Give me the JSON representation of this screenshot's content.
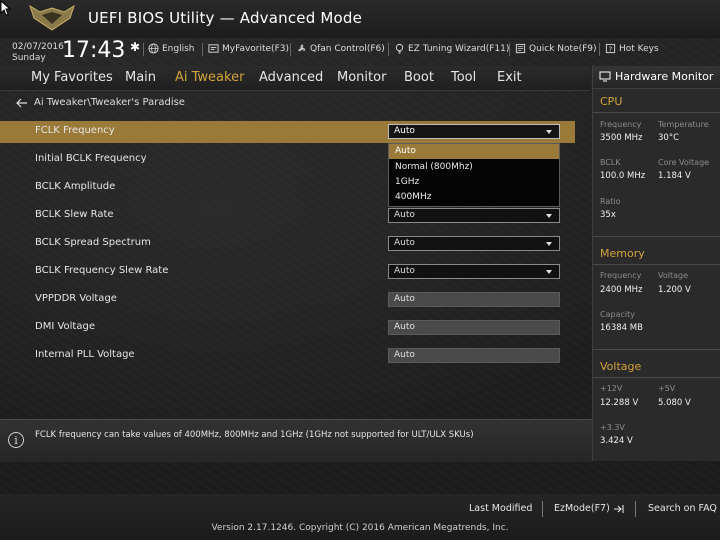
{
  "header": {
    "title": "UEFI BIOS Utility — Advanced Mode",
    "logo_text": "THE ULTIMATE FORCE"
  },
  "status": {
    "date": "02/07/2016",
    "day": "Sunday",
    "time": "17:43"
  },
  "toolbar": {
    "english": "English",
    "myfavorite": "MyFavorite(F3)",
    "qfan": "Qfan Control(F6)",
    "ez_tuning": "EZ Tuning Wizard(F11)",
    "quick_note": "Quick Note(F9)",
    "hot_keys": "Hot Keys"
  },
  "nav": {
    "tabs": [
      {
        "label": "My Favorites"
      },
      {
        "label": "Main"
      },
      {
        "label": "Ai Tweaker"
      },
      {
        "label": "Advanced"
      },
      {
        "label": "Monitor"
      },
      {
        "label": "Boot"
      },
      {
        "label": "Tool"
      },
      {
        "label": "Exit"
      }
    ],
    "active": "Ai Tweaker"
  },
  "breadcrumb": "Ai Tweaker\\Tweaker's Paradise",
  "settings": [
    {
      "label": "FCLK Frequency",
      "value": "Auto"
    },
    {
      "label": "Initial BCLK Frequency",
      "value": "Auto"
    },
    {
      "label": "BCLK Amplitude",
      "value": "Auto"
    },
    {
      "label": "BCLK Slew Rate",
      "value": "Auto"
    },
    {
      "label": "BCLK Spread Spectrum",
      "value": "Auto"
    },
    {
      "label": "BCLK Frequency Slew Rate",
      "value": "Auto"
    },
    {
      "label": "VPPDDR Voltage",
      "value": "Auto"
    },
    {
      "label": "DMI Voltage",
      "value": "Auto"
    },
    {
      "label": "Internal PLL Voltage",
      "value": "Auto"
    }
  ],
  "dropdown": {
    "options": [
      "Auto",
      "Normal (800Mhz)",
      "1GHz",
      "400MHz"
    ],
    "selected": "Auto"
  },
  "help": {
    "text": "FCLK frequency can take values of 400MHz, 800MHz  and 1GHz (1GHz not supported for ULT/ULX SKUs)"
  },
  "hardware_monitor": {
    "title": "Hardware Monitor",
    "cpu": {
      "heading": "CPU",
      "frequency_label": "Frequency",
      "frequency": "3500 MHz",
      "temperature_label": "Temperature",
      "temperature": "30°C",
      "bclk_label": "BCLK",
      "bclk": "100.0 MHz",
      "core_voltage_label": "Core Voltage",
      "core_voltage": "1.184 V",
      "ratio_label": "Ratio",
      "ratio": "35x"
    },
    "memory": {
      "heading": "Memory",
      "frequency_label": "Frequency",
      "frequency": "2400 MHz",
      "voltage_label": "Voltage",
      "voltage": "1.200 V",
      "capacity_label": "Capacity",
      "capacity": "16384 MB"
    },
    "voltage": {
      "heading": "Voltage",
      "v12_label": "+12V",
      "v12": "12.288 V",
      "v5_label": "+5V",
      "v5": "5.080 V",
      "v33_label": "+3.3V",
      "v33": "3.424 V"
    }
  },
  "footer": {
    "last_modified": "Last Modified",
    "ezmode": "EzMode(F7)",
    "search_faq": "Search on FAQ",
    "copyright": "Version 2.17.1246. Copyright (C) 2016 American Megatrends, Inc."
  },
  "colors": {
    "accent": "#d4a33a",
    "highlight": "#9a7a39",
    "panel": "#2a2a2a"
  }
}
